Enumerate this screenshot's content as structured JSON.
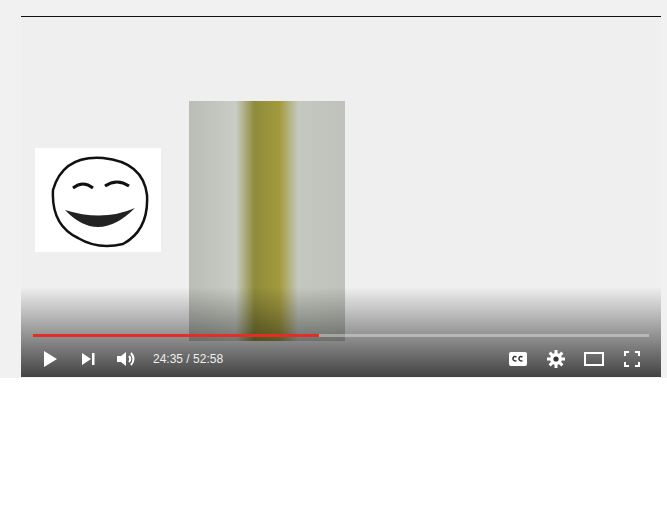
{
  "player": {
    "paused": true,
    "volume": {
      "muted": false
    },
    "progress": {
      "level": 0.464
    },
    "time": "24:35 / 52:58"
  }
}
